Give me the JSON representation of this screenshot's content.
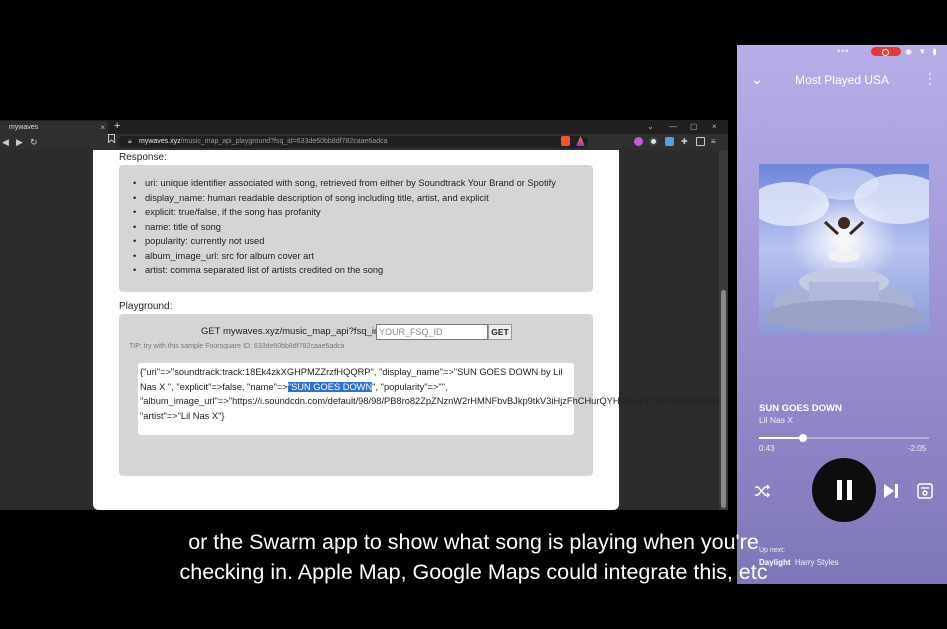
{
  "browser": {
    "tab_title": "mywaves",
    "tab_close": "×",
    "new_tab": "+",
    "win_minimize": "⌄",
    "win_min": "—",
    "win_max": "▢",
    "win_close": "×",
    "nav_back": "◀",
    "nav_forward": "▶",
    "nav_reload": "↻",
    "bookmark": "🔖",
    "url_domain": "mywaves.xyz",
    "url_path": "/music_map_api_playground?fsq_id=633de60bb8df782caae6adca"
  },
  "page": {
    "response_label": "Response:",
    "response_items": [
      "uri: unique identifier associated with song, retrieved from either by Soundtrack Your Brand or Spotify",
      "display_name: human readable description of song including title, artist, and explicit",
      "explicit: true/false, if the song has profanity",
      "name: title of song",
      "popularity: currently not used",
      "album_image_url: src for album cover art",
      "artist: comma separated list of artists credited on the song"
    ],
    "playground_label": "Playground:",
    "get_prefix": "GET mywaves.xyz/music_map_api?fsq_id=",
    "fsq_placeholder": "YOUR_FSQ_ID",
    "get_button": "GET",
    "tip": "TIP: try with this sample Foursquare ID: 633de60bb8df782caae6adca",
    "json_before": "{\"uri\"=>\"soundtrack:track:18Ek4zkXGHPMZZrzfHQQRP\", \"display_name\"=>\"SUN GOES DOWN by Lil Nas X \", \"explicit\"=>false, \"name\"=>",
    "json_highlight": "\"SUN GOES DOWN",
    "json_after": "\", \"popularity\"=>\"\", \"album_image_url\"=>\"https://i.soundcdn.com/default/98/98/PB8ro82ZpZNznW2rHMNFbvBJkp9tkV3iHjzFhCHurQYHddwdNYz2PVKWicKNok7JCXc3ypoZJvNBhxTKZXWTysNJ9WFt8qnpf9PJeGfP6qd62JM4\", \"artist\"=>\"Lil Nas X\"}"
  },
  "phone": {
    "status_dots": "•••",
    "status_icons": "◉ ▼ ▮",
    "collapse": "⌄",
    "playlist_title": "Most Played USA",
    "more": "⋮",
    "song_title": "SUN GOES DOWN",
    "song_artist": "Lil Nas X",
    "progress": 0.26,
    "time_elapsed": "0:43",
    "time_remaining": "-2:05",
    "up_next_label": "Up next:",
    "up_next_song": "Daylight",
    "up_next_artist": "Harry Styles"
  },
  "subtitles": {
    "line1": "or the Swarm app to show what song is playing when you're",
    "line2": "checking in. Apple Map, Google Maps could integrate this, etc"
  },
  "colors": {
    "highlight": "#2f6fd6",
    "rec": "#e53935",
    "phone_bg": "#a69cdc"
  }
}
